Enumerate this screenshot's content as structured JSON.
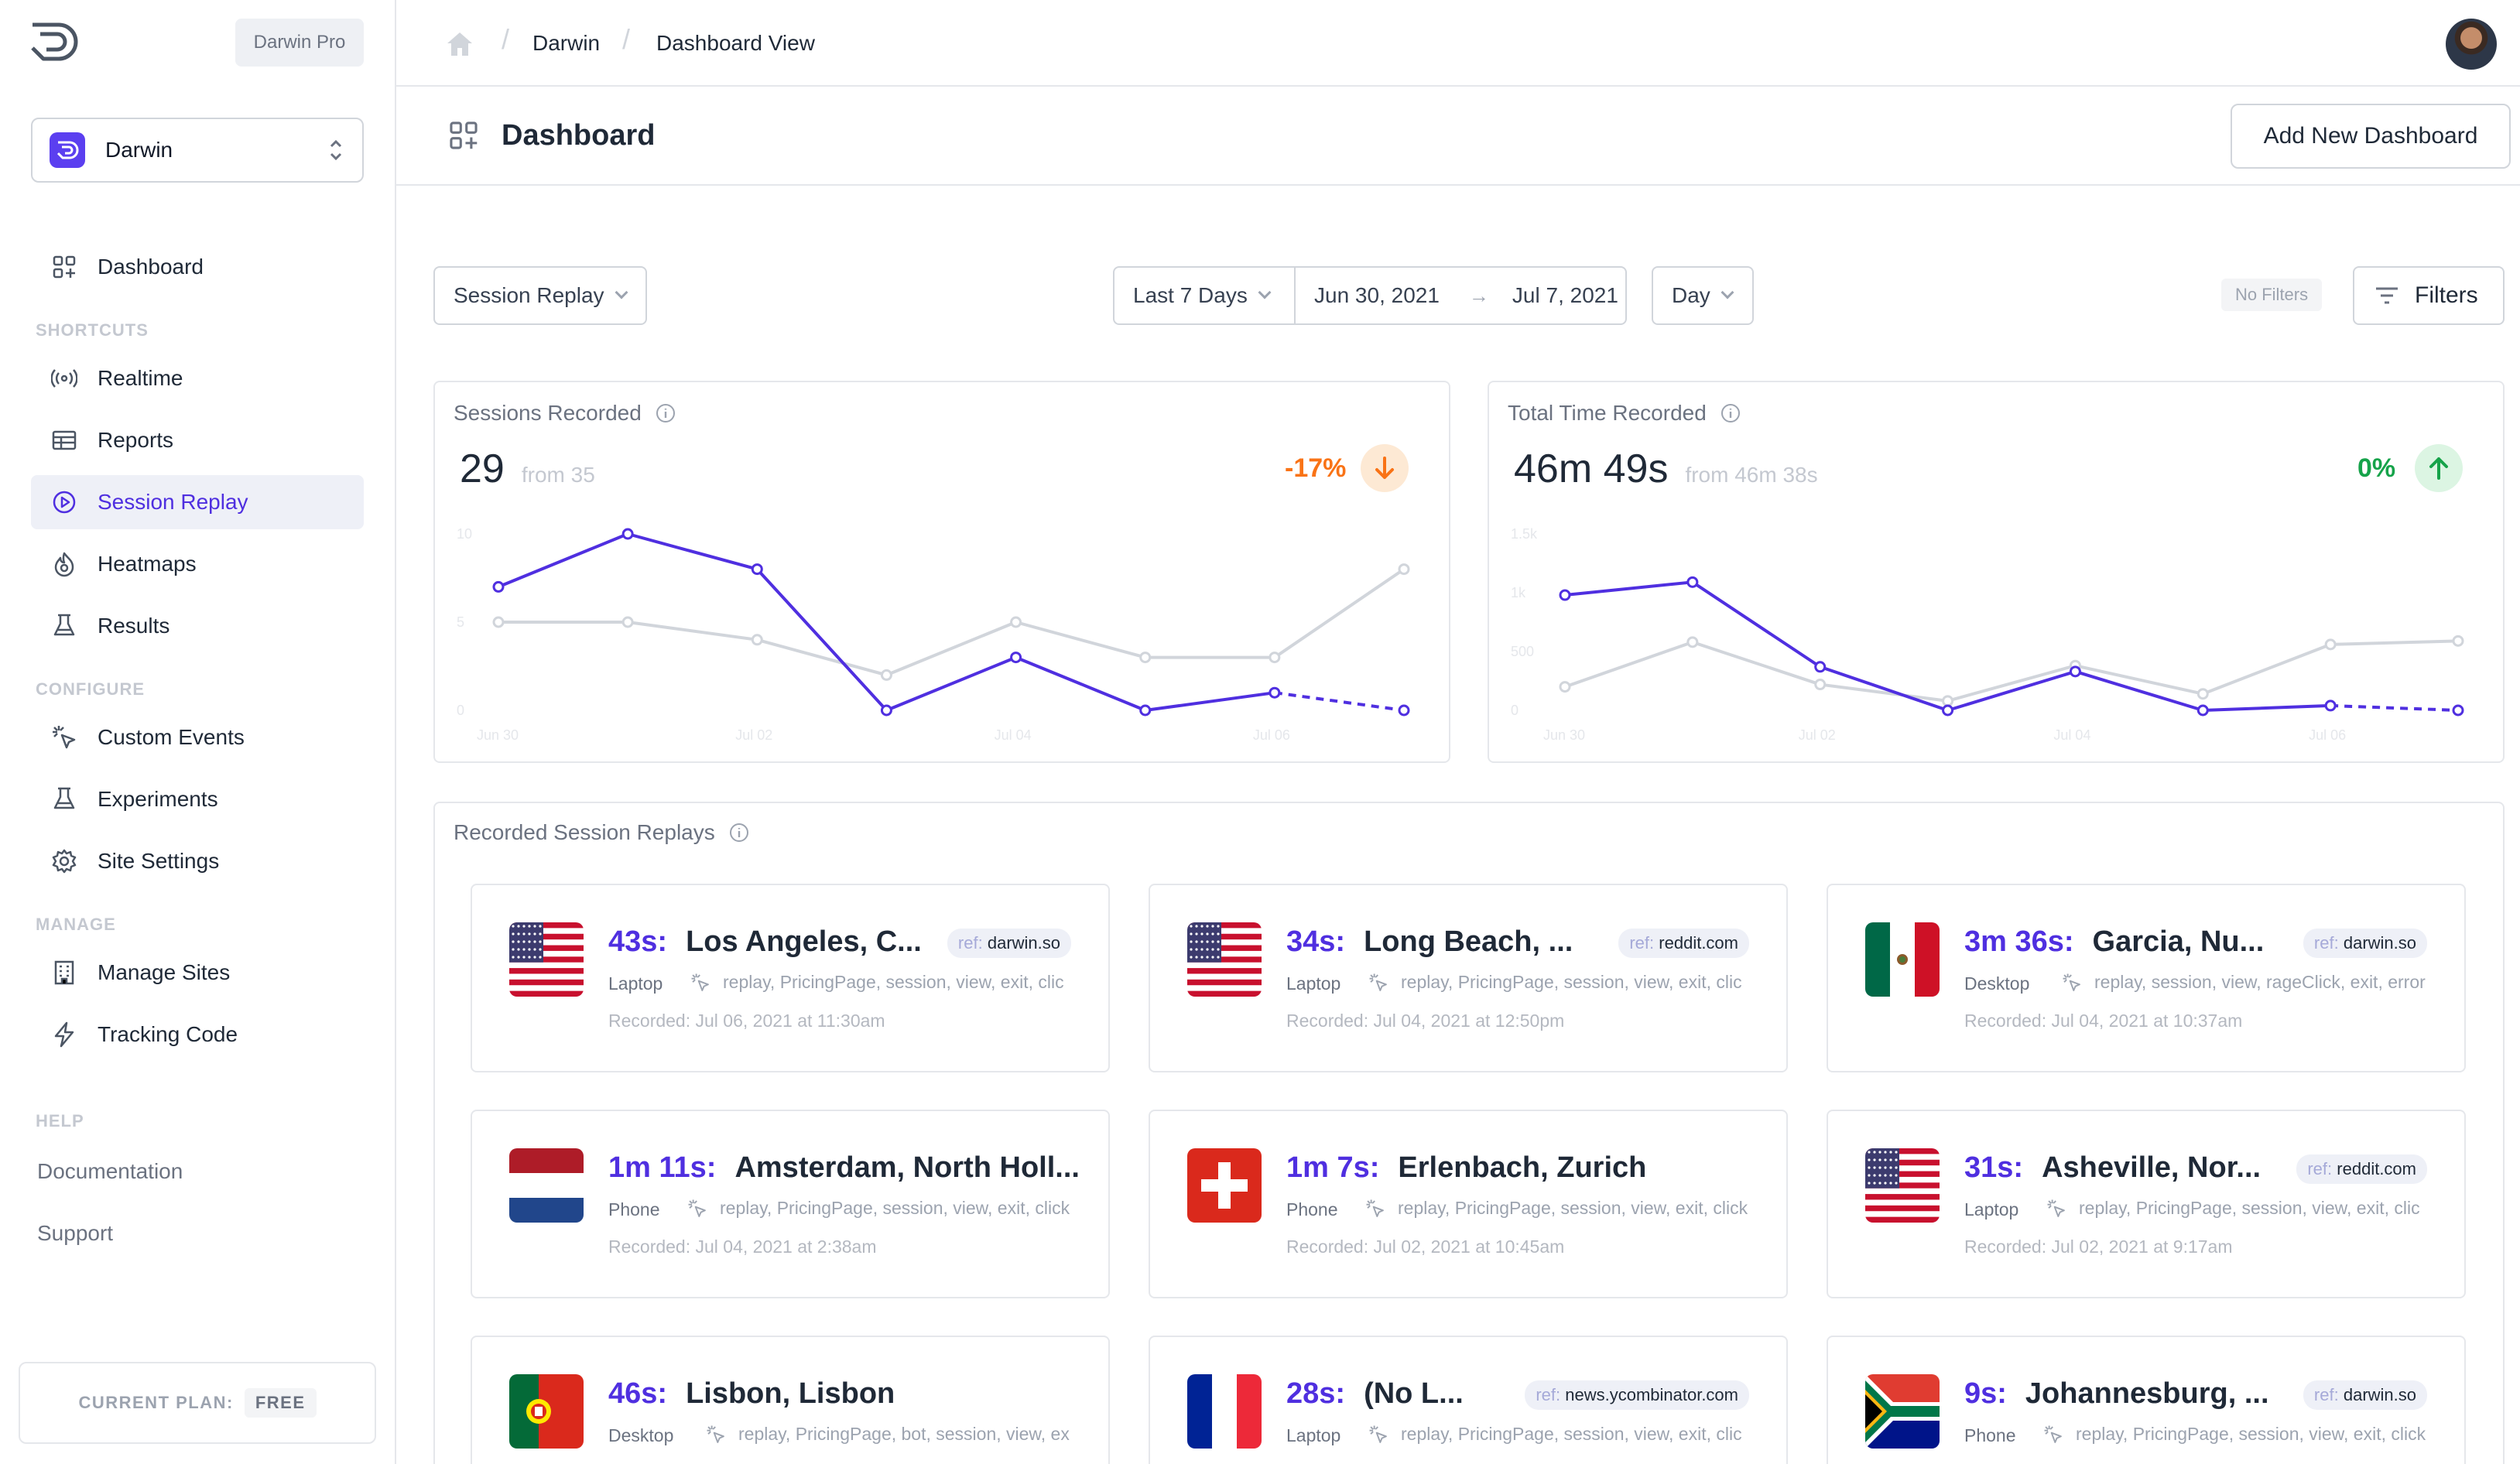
{
  "sidebar": {
    "plan_pill": "Darwin Pro",
    "site_name": "Darwin",
    "dashboard_label": "Dashboard",
    "sections": {
      "shortcuts": "SHORTCUTS",
      "configure": "CONFIGURE",
      "manage": "MANAGE",
      "help": "HELP"
    },
    "shortcuts": [
      {
        "label": "Realtime",
        "icon": "broadcast-icon"
      },
      {
        "label": "Reports",
        "icon": "table-icon"
      },
      {
        "label": "Session Replay",
        "icon": "play-circle-icon",
        "active": true
      },
      {
        "label": "Heatmaps",
        "icon": "flame-icon"
      },
      {
        "label": "Results",
        "icon": "beaker-icon"
      }
    ],
    "configure": [
      {
        "label": "Custom Events",
        "icon": "cursor-click-icon"
      },
      {
        "label": "Experiments",
        "icon": "beaker-icon"
      },
      {
        "label": "Site Settings",
        "icon": "gear-icon"
      }
    ],
    "manage": [
      {
        "label": "Manage Sites",
        "icon": "building-icon"
      },
      {
        "label": "Tracking Code",
        "icon": "lightning-icon"
      }
    ],
    "help": [
      "Documentation",
      "Support"
    ],
    "current_plan_label": "CURRENT PLAN:",
    "current_plan_value": "FREE"
  },
  "breadcrumb": {
    "items": [
      "Darwin",
      "Dashboard View"
    ]
  },
  "header": {
    "title": "Dashboard",
    "add_button": "Add New Dashboard"
  },
  "filters": {
    "view": "Session Replay",
    "range": "Last 7 Days",
    "start": "Jun 30, 2021",
    "end": "Jul 7, 2021",
    "granularity": "Day",
    "no_filters": "No Filters",
    "filters_button": "Filters"
  },
  "colors": {
    "accent": "#4f2fe0",
    "negative": "#f97316",
    "positive": "#16a34a",
    "compare": "#d1d5db"
  },
  "chart_data": [
    {
      "type": "line",
      "title": "Sessions Recorded",
      "value": "29",
      "from": "from 35",
      "change": "-17%",
      "direction": "down",
      "x_ticks": [
        "Jun 30",
        "Jul 02",
        "Jul 04",
        "Jul 06"
      ],
      "y_ticks": [
        "10",
        "5",
        "0"
      ],
      "ylim": [
        0,
        10
      ],
      "x": [
        "Jun 30",
        "Jul 01",
        "Jul 02",
        "Jul 03",
        "Jul 04",
        "Jul 05",
        "Jul 06",
        "Jul 07"
      ],
      "series": [
        {
          "values": [
            7,
            10,
            8,
            0,
            3,
            0,
            1,
            0
          ],
          "color": "#4f2fe0",
          "dashed_last": true
        },
        {
          "values": [
            5,
            5,
            4,
            2,
            5,
            3,
            3,
            8
          ],
          "color": "#d1d5db"
        }
      ]
    },
    {
      "type": "line",
      "title": "Total Time Recorded",
      "value": "46m 49s",
      "from": "from 46m 38s",
      "change": "0%",
      "direction": "up",
      "x_ticks": [
        "Jun 30",
        "Jul 02",
        "Jul 04",
        "Jul 06"
      ],
      "y_ticks": [
        "1.5k",
        "1k",
        "500",
        "0"
      ],
      "ylim": [
        0,
        1500
      ],
      "x": [
        "Jun 30",
        "Jul 01",
        "Jul 02",
        "Jul 03",
        "Jul 04",
        "Jul 05",
        "Jul 06",
        "Jul 07"
      ],
      "series": [
        {
          "values": [
            980,
            1090,
            370,
            0,
            330,
            0,
            40,
            0
          ],
          "color": "#4f2fe0",
          "dashed_last": true
        },
        {
          "values": [
            200,
            580,
            220,
            80,
            380,
            140,
            560,
            590
          ],
          "color": "#d1d5db"
        }
      ]
    }
  ],
  "replays": {
    "title": "Recorded Session Replays",
    "ref_label": "ref:",
    "items": [
      {
        "duration": "43s:",
        "location": "Los Angeles, C...",
        "ref": "darwin.so",
        "device": "Laptop",
        "events": "replay, PricingPage, session, view, exit, clic",
        "recorded": "Recorded: Jul 06, 2021 at 11:30am",
        "flag": "us"
      },
      {
        "duration": "34s:",
        "location": "Long Beach, ...",
        "ref": "reddit.com",
        "device": "Laptop",
        "events": "replay, PricingPage, session, view, exit, clic",
        "recorded": "Recorded: Jul 04, 2021 at 12:50pm",
        "flag": "us"
      },
      {
        "duration": "3m 36s:",
        "location": "Garcia, Nu...",
        "ref": "darwin.so",
        "device": "Desktop",
        "events": "replay, session, view, rageClick, exit, error",
        "recorded": "Recorded: Jul 04, 2021 at 10:37am",
        "flag": "mx"
      },
      {
        "duration": "1m 11s:",
        "location": "Amsterdam, North Holl...",
        "ref": "",
        "device": "Phone",
        "events": "replay, PricingPage, session, view, exit, click",
        "recorded": "Recorded: Jul 04, 2021 at 2:38am",
        "flag": "nl"
      },
      {
        "duration": "1m 7s:",
        "location": "Erlenbach, Zurich",
        "ref": "",
        "device": "Phone",
        "events": "replay, PricingPage, session, view, exit, click",
        "recorded": "Recorded: Jul 02, 2021 at 10:45am",
        "flag": "ch"
      },
      {
        "duration": "31s:",
        "location": "Asheville, Nor...",
        "ref": "reddit.com",
        "device": "Laptop",
        "events": "replay, PricingPage, session, view, exit, clic",
        "recorded": "Recorded: Jul 02, 2021 at 9:17am",
        "flag": "us"
      },
      {
        "duration": "46s:",
        "location": "Lisbon, Lisbon",
        "ref": "",
        "device": "Desktop",
        "events": "replay, PricingPage, bot, session, view, ex",
        "recorded": "",
        "flag": "pt"
      },
      {
        "duration": "28s:",
        "location": "(No L...",
        "ref": "news.ycombinator.com",
        "device": "Laptop",
        "events": "replay, PricingPage, session, view, exit, clic",
        "recorded": "",
        "flag": "fr"
      },
      {
        "duration": "9s:",
        "location": "Johannesburg, ...",
        "ref": "darwin.so",
        "device": "Phone",
        "events": "replay, PricingPage, session, view, exit, click",
        "recorded": "",
        "flag": "za"
      }
    ]
  }
}
